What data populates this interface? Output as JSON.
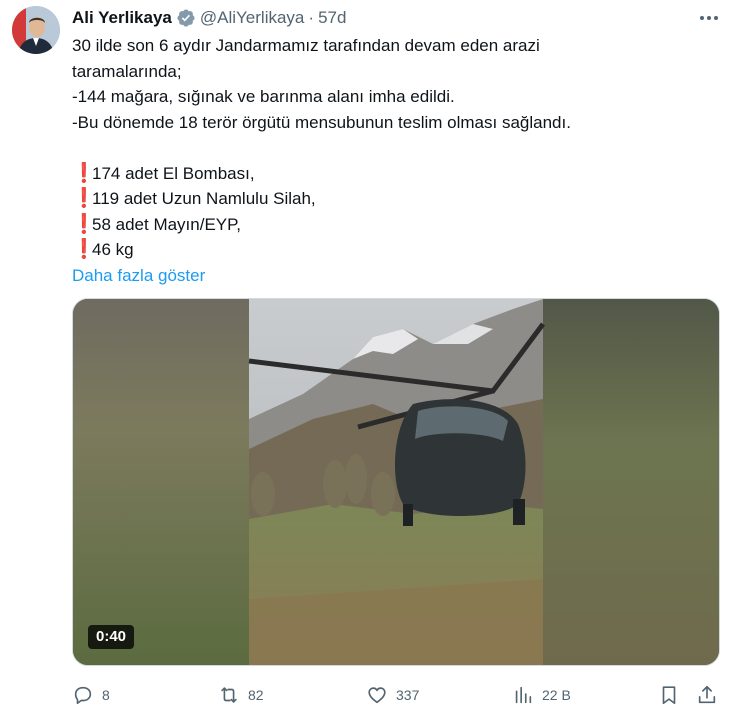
{
  "author": {
    "name": "Ali Yerlikaya",
    "handle": "@AliYerlikaya",
    "separator": "·",
    "time": "57d"
  },
  "tweet": {
    "lines": [
      "30 ilde son 6 aydır Jandarmamız tarafından devam eden arazi",
      "taramalarında;",
      "-144 mağara, sığınak ve barınma alanı imha edildi.",
      "-Bu dönemde 18 terör örgütü mensubunun teslim olması sağlandı."
    ],
    "bullet_symbol": "❗",
    "bullets": [
      "174 adet El Bombası,",
      "119 adet Uzun Namlulu Silah,",
      "58 adet Mayın/EYP,",
      "46 kg"
    ],
    "show_more": "Daha fazla göster"
  },
  "media": {
    "duration": "0:40"
  },
  "actions": {
    "replies": "8",
    "reposts": "82",
    "likes": "337",
    "views": "22 B"
  },
  "colors": {
    "link": "#1d9bf0",
    "muted": "#536471",
    "text": "#0f1419",
    "verified": "#829aab",
    "alert": "#dd1f2f"
  },
  "icons": [
    "verified-badge-icon",
    "more-icon",
    "reply-icon",
    "repost-icon",
    "like-icon",
    "views-icon",
    "bookmark-icon",
    "share-icon"
  ]
}
